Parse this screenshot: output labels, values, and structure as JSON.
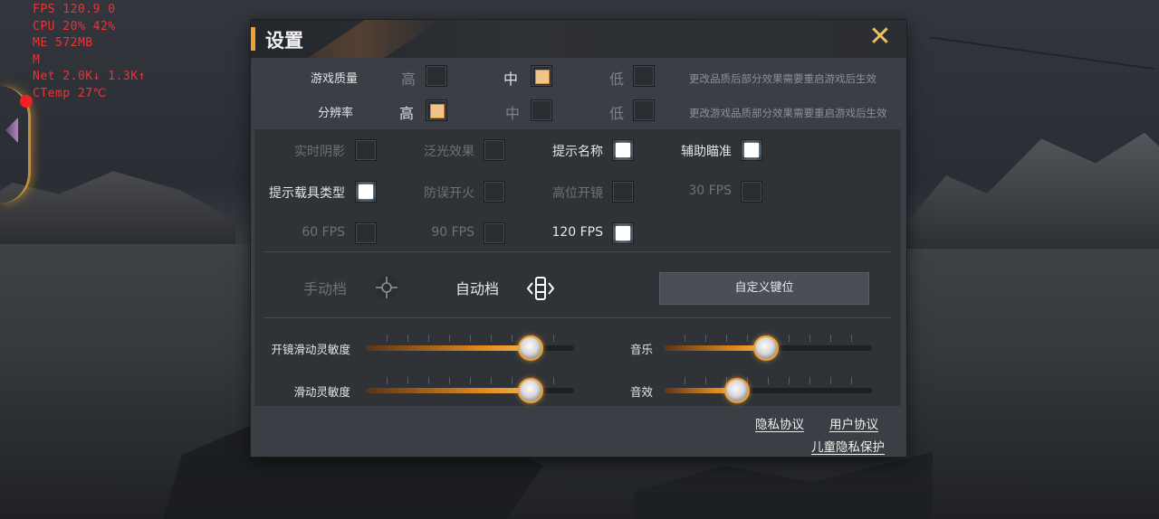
{
  "hud": {
    "lines": [
      "FPS  120.9  0",
      "CPU  20%  42%",
      "ME  572MB",
      "M",
      "Net  2.0K↓  1.3K↑",
      "CTemp  27℃"
    ]
  },
  "dialog": {
    "title": "设置",
    "close_icon": "close-x-icon"
  },
  "quality": {
    "label": "游戏质量",
    "options": [
      {
        "label": "高",
        "selected": false
      },
      {
        "label": "中",
        "selected": true
      },
      {
        "label": "低",
        "selected": false
      }
    ],
    "note": "更改品质后部分效果需要重启游戏后生效"
  },
  "resolution": {
    "label": "分辨率",
    "options": [
      {
        "label": "高",
        "selected": true
      },
      {
        "label": "中",
        "selected": false
      },
      {
        "label": "低",
        "selected": false
      }
    ],
    "note": "更改游戏品质部分效果需要重启游戏后生效"
  },
  "toggles": [
    {
      "label": "实时阴影",
      "enabled": false,
      "checked": false
    },
    {
      "label": "泛光效果",
      "enabled": false,
      "checked": false
    },
    {
      "label": "提示名称",
      "enabled": true,
      "checked": true
    },
    {
      "label": "辅助瞄准",
      "enabled": true,
      "checked": true
    },
    {
      "label": "提示载具类型",
      "enabled": true,
      "checked": true
    },
    {
      "label": "防误开火",
      "enabled": false,
      "checked": false
    },
    {
      "label": "高位开镜",
      "enabled": false,
      "checked": false
    },
    {
      "label": "30 FPS",
      "enabled": false,
      "checked": false
    },
    {
      "label": "60 FPS",
      "enabled": false,
      "checked": false
    },
    {
      "label": "90 FPS",
      "enabled": false,
      "checked": false
    },
    {
      "label": "120 FPS",
      "enabled": true,
      "checked": true
    }
  ],
  "gear": {
    "manual_label": "手动档",
    "auto_label": "自动档",
    "selected": "auto",
    "custom_button": "自定义键位"
  },
  "sliders": [
    {
      "label": "开镜滑动灵敏度",
      "value": 0.79
    },
    {
      "label": "音乐",
      "value": 0.49
    },
    {
      "label": "滑动灵敏度",
      "value": 0.79
    },
    {
      "label": "音效",
      "value": 0.35
    }
  ],
  "links": {
    "privacy": "隐私协议",
    "user": "用户协议",
    "child_privacy": "儿童隐私保护"
  },
  "colors": {
    "accent": "#f0a030",
    "panel": "#2f3338",
    "dialog": "#3b3f45"
  }
}
